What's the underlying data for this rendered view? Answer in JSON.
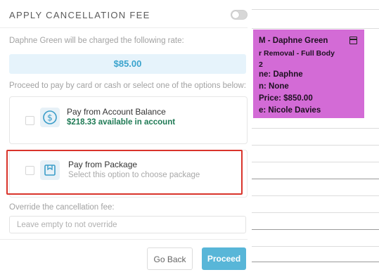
{
  "modal": {
    "title": "APPLY CANCELLATION FEE",
    "charge_notice": "Daphne Green will be charged the following rate:",
    "rate": "$85.00",
    "options_prompt": "Proceed to pay by card or cash or select one of the options below:",
    "options": [
      {
        "title": "Pay from Account Balance",
        "subtitle": "$218.33 available in account",
        "icon": "dollar-circle-icon",
        "subtitle_color": "#1f7a55"
      },
      {
        "title": "Pay from Package",
        "subtitle": "Select this option to choose package",
        "icon": "package-icon",
        "subtitle_color": "#a9a9a9"
      }
    ],
    "override_label": "Override the cancellation fee:",
    "override_placeholder": "Leave empty to not override",
    "override_value": "",
    "go_back_label": "Go Back",
    "proceed_label": "Proceed"
  },
  "appointment": {
    "color": "#d36bd6",
    "line1": "M - Daphne Green",
    "line2": "r Removal - Full Body",
    "line3": "2",
    "line4": "ne: Daphne",
    "line5": "n: None",
    "line6": "Price: $850.00",
    "line7": "e: Nicole Davies",
    "icon": "calendar-icon"
  },
  "colors": {
    "accent": "#58b6d8",
    "highlight": "#d9342b"
  }
}
